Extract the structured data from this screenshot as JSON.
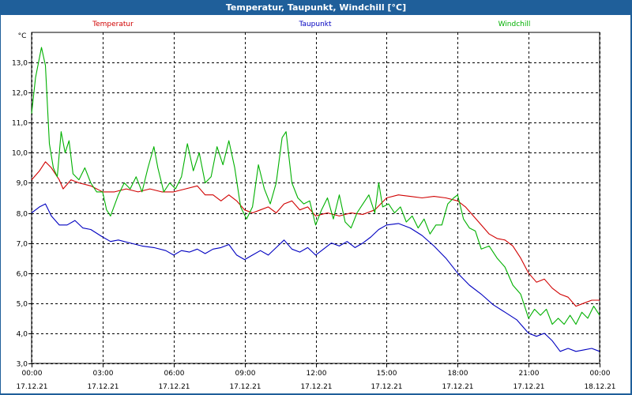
{
  "window": {
    "title": "Temperatur, Taupunkt, Windchill [°C]"
  },
  "chart_data": {
    "type": "line",
    "title": "Temperatur, Taupunkt, Windchill [°C]",
    "ylabel": "°C",
    "ylim": [
      3.0,
      14.0
    ],
    "xlim_hours": [
      0,
      24
    ],
    "grid": true,
    "legend_position": "top",
    "y_ticks": [
      "3,0",
      "4,0",
      "5,0",
      "6,0",
      "7,0",
      "8,0",
      "9,0",
      "10,0",
      "11,0",
      "12,0",
      "13,0"
    ],
    "x_ticks": [
      {
        "time": "00:00",
        "date": "17.12.21"
      },
      {
        "time": "03:00",
        "date": "17.12.21"
      },
      {
        "time": "06:00",
        "date": "17.12.21"
      },
      {
        "time": "09:00",
        "date": "17.12.21"
      },
      {
        "time": "12:00",
        "date": "17.12.21"
      },
      {
        "time": "15:00",
        "date": "17.12.21"
      },
      {
        "time": "18:00",
        "date": "17.12.21"
      },
      {
        "time": "21:00",
        "date": "17.12.21"
      },
      {
        "time": "00:00",
        "date": "18.12.21"
      }
    ],
    "series": [
      {
        "name": "Temperatur",
        "color": "#d00000",
        "points": [
          [
            "00:00",
            9.1
          ],
          [
            "00:20",
            9.4
          ],
          [
            "00:35",
            9.7
          ],
          [
            "00:50",
            9.5
          ],
          [
            "01:10",
            9.1
          ],
          [
            "01:20",
            8.8
          ],
          [
            "01:40",
            9.1
          ],
          [
            "02:00",
            9.0
          ],
          [
            "02:30",
            8.9
          ],
          [
            "03:00",
            8.7
          ],
          [
            "03:30",
            8.7
          ],
          [
            "04:00",
            8.8
          ],
          [
            "04:30",
            8.7
          ],
          [
            "05:00",
            8.8
          ],
          [
            "05:30",
            8.7
          ],
          [
            "06:00",
            8.7
          ],
          [
            "06:30",
            8.8
          ],
          [
            "07:00",
            8.9
          ],
          [
            "07:20",
            8.6
          ],
          [
            "07:40",
            8.6
          ],
          [
            "08:00",
            8.4
          ],
          [
            "08:20",
            8.6
          ],
          [
            "08:40",
            8.4
          ],
          [
            "09:00",
            8.1
          ],
          [
            "09:20",
            8.0
          ],
          [
            "09:40",
            8.1
          ],
          [
            "10:00",
            8.2
          ],
          [
            "10:20",
            8.0
          ],
          [
            "10:40",
            8.3
          ],
          [
            "11:00",
            8.4
          ],
          [
            "11:20",
            8.1
          ],
          [
            "11:40",
            8.2
          ],
          [
            "12:00",
            7.9
          ],
          [
            "12:30",
            8.0
          ],
          [
            "13:00",
            7.9
          ],
          [
            "13:30",
            8.0
          ],
          [
            "14:00",
            7.95
          ],
          [
            "14:30",
            8.1
          ],
          [
            "15:00",
            8.5
          ],
          [
            "15:30",
            8.6
          ],
          [
            "16:00",
            8.55
          ],
          [
            "16:30",
            8.5
          ],
          [
            "17:00",
            8.55
          ],
          [
            "17:30",
            8.5
          ],
          [
            "18:00",
            8.4
          ],
          [
            "18:20",
            8.2
          ],
          [
            "18:40",
            7.9
          ],
          [
            "19:00",
            7.6
          ],
          [
            "19:20",
            7.3
          ],
          [
            "19:40",
            7.15
          ],
          [
            "20:00",
            7.1
          ],
          [
            "20:20",
            6.9
          ],
          [
            "20:40",
            6.5
          ],
          [
            "21:00",
            6.0
          ],
          [
            "21:20",
            5.7
          ],
          [
            "21:40",
            5.8
          ],
          [
            "22:00",
            5.5
          ],
          [
            "22:20",
            5.3
          ],
          [
            "22:40",
            5.2
          ],
          [
            "23:00",
            4.9
          ],
          [
            "23:20",
            5.0
          ],
          [
            "23:40",
            5.1
          ],
          [
            "24:00",
            5.1
          ]
        ]
      },
      {
        "name": "Taupunkt",
        "color": "#0000c0",
        "points": [
          [
            "00:00",
            8.0
          ],
          [
            "00:20",
            8.2
          ],
          [
            "00:35",
            8.3
          ],
          [
            "00:50",
            7.9
          ],
          [
            "01:10",
            7.6
          ],
          [
            "01:30",
            7.6
          ],
          [
            "01:50",
            7.75
          ],
          [
            "02:10",
            7.5
          ],
          [
            "02:30",
            7.45
          ],
          [
            "03:00",
            7.2
          ],
          [
            "03:20",
            7.05
          ],
          [
            "03:40",
            7.1
          ],
          [
            "04:10",
            7.0
          ],
          [
            "04:40",
            6.9
          ],
          [
            "05:10",
            6.85
          ],
          [
            "05:40",
            6.75
          ],
          [
            "06:00",
            6.6
          ],
          [
            "06:20",
            6.75
          ],
          [
            "06:40",
            6.7
          ],
          [
            "07:00",
            6.8
          ],
          [
            "07:20",
            6.65
          ],
          [
            "07:40",
            6.8
          ],
          [
            "08:00",
            6.85
          ],
          [
            "08:20",
            6.95
          ],
          [
            "08:40",
            6.6
          ],
          [
            "09:00",
            6.45
          ],
          [
            "09:20",
            6.6
          ],
          [
            "09:40",
            6.75
          ],
          [
            "10:00",
            6.6
          ],
          [
            "10:20",
            6.85
          ],
          [
            "10:40",
            7.1
          ],
          [
            "11:00",
            6.8
          ],
          [
            "11:20",
            6.7
          ],
          [
            "11:40",
            6.85
          ],
          [
            "12:00",
            6.6
          ],
          [
            "12:20",
            6.8
          ],
          [
            "12:40",
            7.0
          ],
          [
            "13:00",
            6.9
          ],
          [
            "13:20",
            7.05
          ],
          [
            "13:40",
            6.85
          ],
          [
            "14:00",
            7.0
          ],
          [
            "14:20",
            7.2
          ],
          [
            "14:40",
            7.45
          ],
          [
            "15:00",
            7.6
          ],
          [
            "15:30",
            7.65
          ],
          [
            "16:00",
            7.5
          ],
          [
            "16:30",
            7.25
          ],
          [
            "17:00",
            6.9
          ],
          [
            "17:30",
            6.5
          ],
          [
            "18:00",
            6.0
          ],
          [
            "18:30",
            5.6
          ],
          [
            "19:00",
            5.3
          ],
          [
            "19:30",
            4.95
          ],
          [
            "20:00",
            4.7
          ],
          [
            "20:30",
            4.45
          ],
          [
            "21:00",
            4.0
          ],
          [
            "21:20",
            3.9
          ],
          [
            "21:40",
            4.0
          ],
          [
            "22:00",
            3.75
          ],
          [
            "22:20",
            3.4
          ],
          [
            "22:40",
            3.5
          ],
          [
            "23:00",
            3.4
          ],
          [
            "23:20",
            3.45
          ],
          [
            "23:40",
            3.5
          ],
          [
            "24:00",
            3.4
          ]
        ]
      },
      {
        "name": "Windchill",
        "color": "#00b000",
        "points": [
          [
            "00:00",
            11.3
          ],
          [
            "00:10",
            12.5
          ],
          [
            "00:25",
            13.5
          ],
          [
            "00:35",
            12.9
          ],
          [
            "00:45",
            10.3
          ],
          [
            "00:55",
            9.5
          ],
          [
            "01:05",
            9.2
          ],
          [
            "01:15",
            10.7
          ],
          [
            "01:25",
            10.0
          ],
          [
            "01:35",
            10.4
          ],
          [
            "01:45",
            9.3
          ],
          [
            "02:00",
            9.1
          ],
          [
            "02:15",
            9.5
          ],
          [
            "02:30",
            9.0
          ],
          [
            "02:45",
            8.7
          ],
          [
            "03:00",
            8.7
          ],
          [
            "03:10",
            8.1
          ],
          [
            "03:20",
            7.9
          ],
          [
            "03:40",
            8.6
          ],
          [
            "03:55",
            9.0
          ],
          [
            "04:10",
            8.8
          ],
          [
            "04:25",
            9.2
          ],
          [
            "04:40",
            8.7
          ],
          [
            "04:55",
            9.5
          ],
          [
            "05:10",
            10.2
          ],
          [
            "05:20",
            9.5
          ],
          [
            "05:35",
            8.7
          ],
          [
            "05:50",
            9.0
          ],
          [
            "06:05",
            8.8
          ],
          [
            "06:20",
            9.2
          ],
          [
            "06:35",
            10.3
          ],
          [
            "06:50",
            9.4
          ],
          [
            "07:05",
            10.0
          ],
          [
            "07:20",
            9.0
          ],
          [
            "07:35",
            9.2
          ],
          [
            "07:50",
            10.2
          ],
          [
            "08:05",
            9.6
          ],
          [
            "08:20",
            10.4
          ],
          [
            "08:35",
            9.5
          ],
          [
            "08:50",
            8.2
          ],
          [
            "09:05",
            7.8
          ],
          [
            "09:20",
            8.2
          ],
          [
            "09:35",
            9.6
          ],
          [
            "09:50",
            8.8
          ],
          [
            "10:05",
            8.3
          ],
          [
            "10:20",
            9.0
          ],
          [
            "10:35",
            10.5
          ],
          [
            "10:45",
            10.7
          ],
          [
            "11:00",
            9.0
          ],
          [
            "11:15",
            8.5
          ],
          [
            "11:30",
            8.3
          ],
          [
            "11:45",
            8.4
          ],
          [
            "12:00",
            7.6
          ],
          [
            "12:15",
            8.1
          ],
          [
            "12:30",
            8.5
          ],
          [
            "12:45",
            7.8
          ],
          [
            "13:00",
            8.6
          ],
          [
            "13:15",
            7.7
          ],
          [
            "13:30",
            7.5
          ],
          [
            "13:45",
            8.0
          ],
          [
            "14:00",
            8.3
          ],
          [
            "14:15",
            8.6
          ],
          [
            "14:30",
            8.0
          ],
          [
            "14:40",
            9.0
          ],
          [
            "14:50",
            8.2
          ],
          [
            "15:05",
            8.3
          ],
          [
            "15:20",
            8.0
          ],
          [
            "15:35",
            8.2
          ],
          [
            "15:50",
            7.7
          ],
          [
            "16:05",
            7.9
          ],
          [
            "16:20",
            7.5
          ],
          [
            "16:35",
            7.8
          ],
          [
            "16:50",
            7.3
          ],
          [
            "17:05",
            7.6
          ],
          [
            "17:20",
            7.6
          ],
          [
            "17:35",
            8.3
          ],
          [
            "17:50",
            8.5
          ],
          [
            "18:00",
            8.6
          ],
          [
            "18:15",
            7.8
          ],
          [
            "18:30",
            7.5
          ],
          [
            "18:45",
            7.4
          ],
          [
            "19:00",
            6.8
          ],
          [
            "19:20",
            6.9
          ],
          [
            "19:40",
            6.5
          ],
          [
            "20:00",
            6.2
          ],
          [
            "20:20",
            5.6
          ],
          [
            "20:40",
            5.3
          ],
          [
            "21:00",
            4.5
          ],
          [
            "21:15",
            4.8
          ],
          [
            "21:30",
            4.6
          ],
          [
            "21:45",
            4.8
          ],
          [
            "22:00",
            4.3
          ],
          [
            "22:15",
            4.5
          ],
          [
            "22:30",
            4.3
          ],
          [
            "22:45",
            4.6
          ],
          [
            "23:00",
            4.3
          ],
          [
            "23:15",
            4.7
          ],
          [
            "23:30",
            4.5
          ],
          [
            "23:45",
            4.9
          ],
          [
            "24:00",
            4.6
          ]
        ]
      }
    ]
  }
}
